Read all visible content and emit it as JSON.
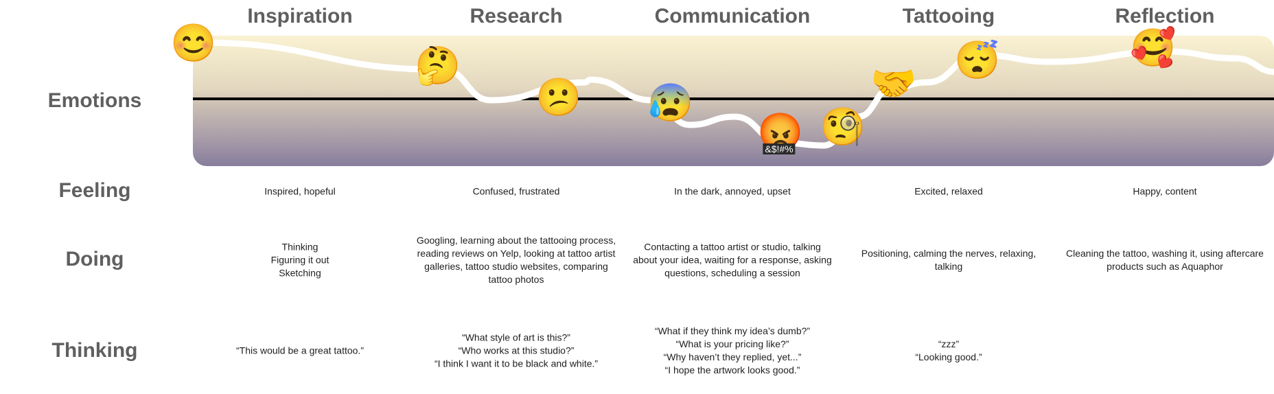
{
  "phases": [
    {
      "title": "Inspiration",
      "feeling": "Inspired, hopeful",
      "doing": [
        "Thinking",
        "Figuring it out",
        "Sketching"
      ],
      "thinking": [
        "“This would be a great tattoo.”"
      ]
    },
    {
      "title": "Research",
      "feeling": "Confused, frustrated",
      "doing": [
        "Googling, learning about the tattooing process,",
        "reading reviews on Yelp, looking at tattoo artist",
        "galleries, tattoo studio websites, comparing",
        "tattoo photos"
      ],
      "thinking": [
        "“What style of art is this?”",
        "“Who works at this studio?”",
        "“I think I want it to be black and white.”"
      ]
    },
    {
      "title": "Communication",
      "feeling": "In the dark, annoyed, upset",
      "doing": [
        "Contacting a tattoo artist or studio, talking",
        "about your idea, waiting for a response, asking",
        "questions, scheduling a session"
      ],
      "thinking": [
        "“What if they think my idea’s dumb?”",
        "“What is your pricing like?”",
        "“Why haven’t they replied, yet...”",
        "“I hope the artwork looks good.”"
      ]
    },
    {
      "title": "Tattooing",
      "feeling": "Excited, relaxed",
      "doing": [
        "Positioning, calming the nerves, relaxing,",
        "talking"
      ],
      "thinking": [
        "“zzz”",
        "“Looking good.”"
      ]
    },
    {
      "title": "Reflection",
      "feeling": "Happy, content",
      "doing": [
        "Cleaning the tattoo, washing it, using aftercare",
        "products such as Aquaphor"
      ],
      "thinking": []
    }
  ],
  "row_labels": {
    "emotions": "Emotions",
    "feeling": "Feeling",
    "doing": "Doing",
    "thinking": "Thinking"
  },
  "emotion_points": [
    {
      "emoji": "😊",
      "name": "smiling-face-icon",
      "level": 0.85,
      "x_pos": 0.0
    },
    {
      "emoji": "🤔",
      "name": "thinking-face-icon",
      "level": 0.5,
      "x_pos": 1.13
    },
    {
      "emoji": "😕",
      "name": "confused-face-icon",
      "level": 0.0,
      "x_pos": 1.69
    },
    {
      "emoji": "😰",
      "name": "anxious-sweat-face-icon",
      "level": -0.1,
      "x_pos": 2.22
    },
    {
      "emoji": "😡",
      "name": "angry-face-icon",
      "level": -0.55,
      "x_pos": 2.74,
      "caption": "&$!#%"
    },
    {
      "emoji": "🧐",
      "name": "monocle-face-icon",
      "level": -0.45,
      "x_pos": 3.12
    },
    {
      "emoji": "🤝",
      "name": "handshake-icon",
      "level": 0.2,
      "x_pos": 3.42
    },
    {
      "emoji": "😴",
      "name": "sleeping-face-icon",
      "level": 0.55,
      "x_pos": 3.61
    },
    {
      "emoji": "🥰",
      "name": "smiling-face-hearts-icon",
      "level": 0.7,
      "x_pos": 4.59
    }
  ],
  "colors": {
    "label": "#5f5f5f",
    "band_top": "#faf2d2",
    "band_bottom": "#877d9c",
    "curve": "#ffffff",
    "baseline": "#000000"
  }
}
